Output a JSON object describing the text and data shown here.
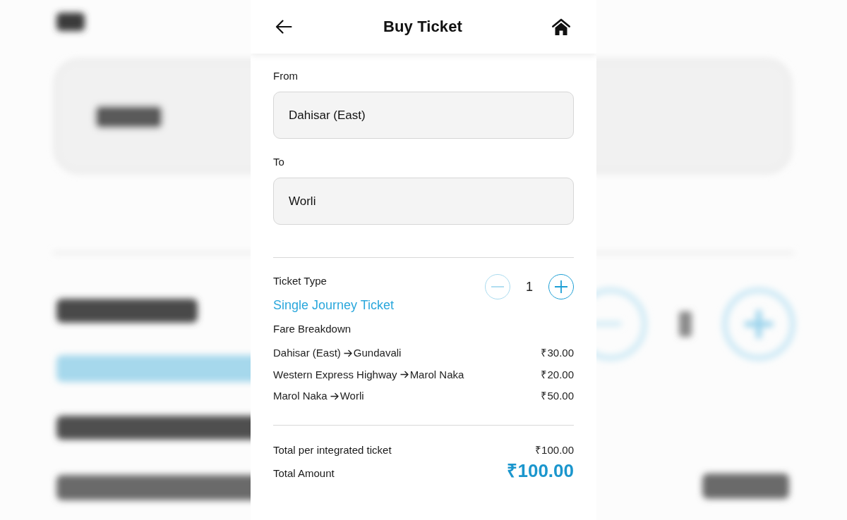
{
  "header": {
    "title": "Buy Ticket"
  },
  "route": {
    "from": {
      "label": "From",
      "value": "Dahisar (East)"
    },
    "to": {
      "label": "To",
      "value": "Worli"
    }
  },
  "ticket": {
    "label": "Ticket Type",
    "type": "Single Journey Ticket",
    "quantity": "1",
    "decrease": {
      "disabled": true
    },
    "increase": {
      "disabled": false
    }
  },
  "fare_breakdown": {
    "title": "Fare Breakdown",
    "segments": [
      {
        "from": "Dahisar (East)",
        "to": "Gundavali",
        "amount": "₹30.00"
      },
      {
        "from": "Western Express Highway",
        "to": "Marol Naka",
        "amount": "₹20.00"
      },
      {
        "from": "Marol Naka",
        "to": "Worli",
        "amount": "₹50.00"
      }
    ]
  },
  "totals": {
    "per_ticket": {
      "label": "Total per integrated ticket",
      "amount": "₹100.00"
    },
    "total": {
      "label": "Total Amount",
      "amount": "₹100.00"
    }
  }
}
